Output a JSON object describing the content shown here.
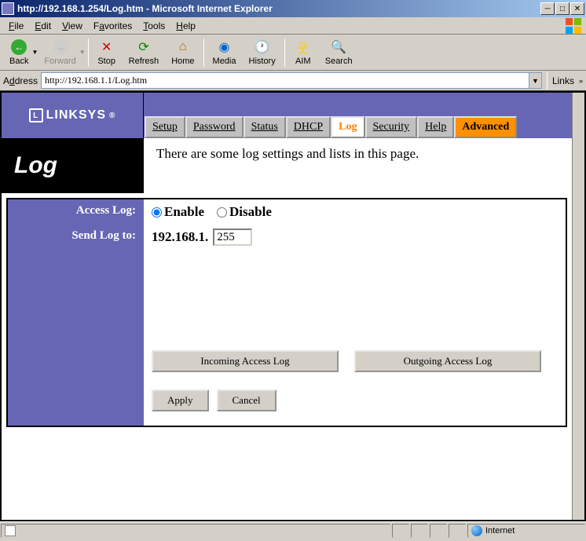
{
  "window": {
    "title": "http://192.168.1.254/Log.htm - Microsoft Internet Explorer"
  },
  "menubar": {
    "file": "File",
    "edit": "Edit",
    "view": "View",
    "favorites": "Favorites",
    "tools": "Tools",
    "help": "Help"
  },
  "toolbar": {
    "back": "Back",
    "forward": "Forward",
    "stop": "Stop",
    "refresh": "Refresh",
    "home": "Home",
    "media": "Media",
    "history": "History",
    "aim": "AIM",
    "search": "Search"
  },
  "addressbar": {
    "label": "Address",
    "url": "http://192.168.1.1/Log.htm",
    "links": "Links"
  },
  "page": {
    "brand": "LINKSYS",
    "brand_reg": "®",
    "tabs": {
      "setup": "Setup",
      "password": "Password",
      "status": "Status",
      "dhcp": "DHCP",
      "log": "Log",
      "security": "Security",
      "help": "Help",
      "advanced": "Advanced"
    },
    "title": "Log",
    "description": "There are some log settings and lists in this page.",
    "labels": {
      "access_log": "Access Log:",
      "send_log_to": "Send Log to:"
    },
    "radio": {
      "enable": "Enable",
      "disable": "Disable",
      "selected": "enable"
    },
    "ip_prefix": "192.168.1.",
    "ip_last_octet": "255",
    "buttons": {
      "incoming": "Incoming Access Log",
      "outgoing": "Outgoing Access Log",
      "apply": "Apply",
      "cancel": "Cancel"
    }
  },
  "statusbar": {
    "zone": "Internet"
  }
}
